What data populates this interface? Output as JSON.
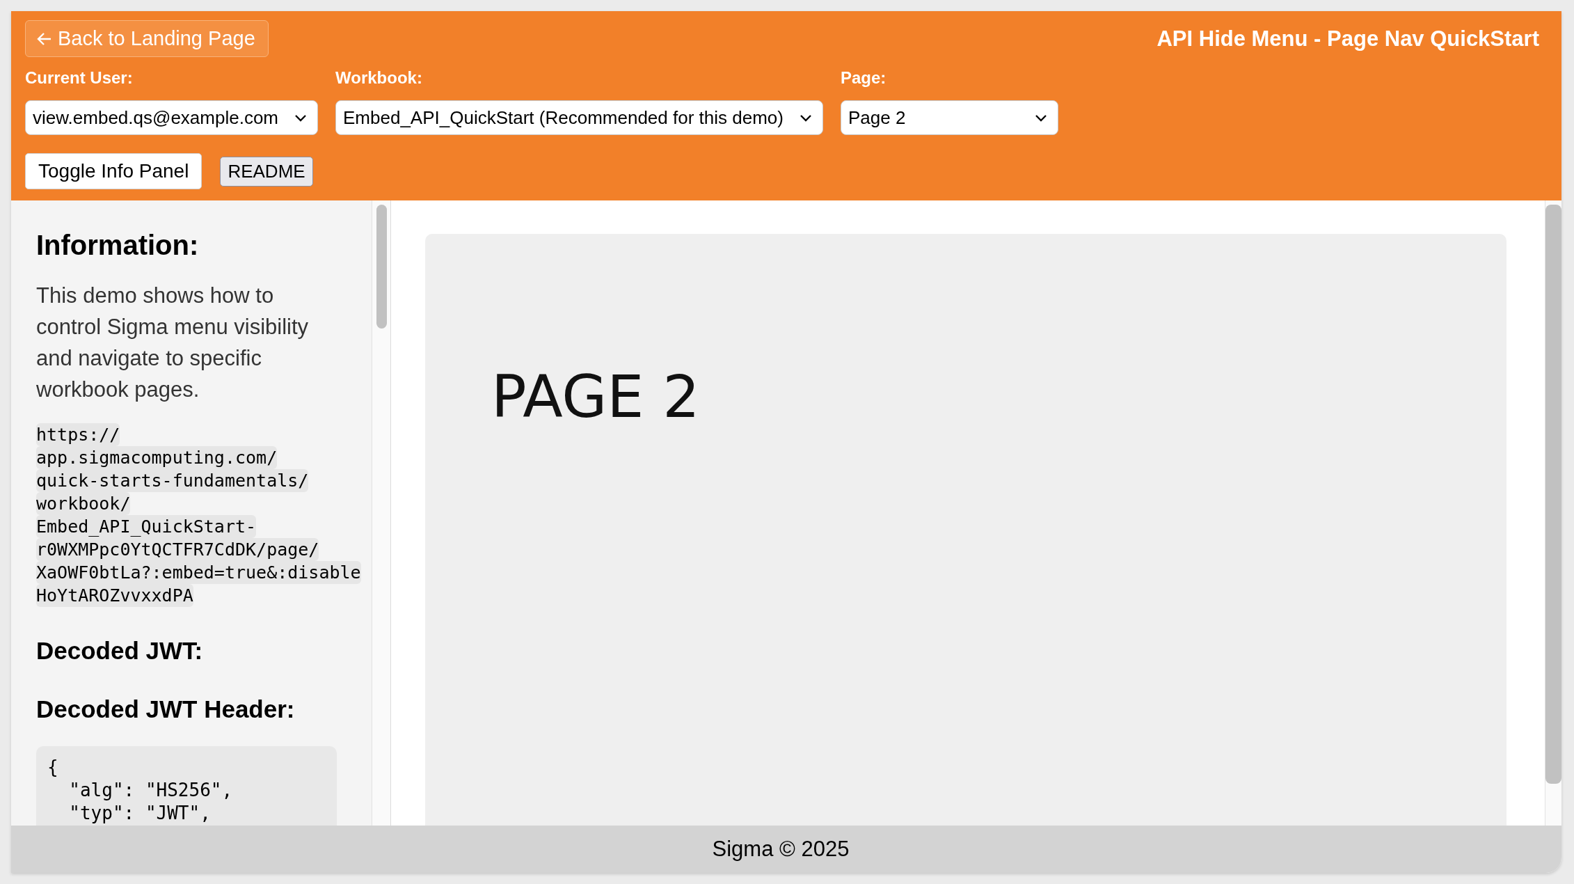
{
  "header": {
    "back_button": "Back to Landing Page",
    "title": "API Hide Menu - Page Nav QuickStart",
    "selectors": [
      {
        "label": "Current User:",
        "value": "view.embed.qs@example.com"
      },
      {
        "label": "Workbook:",
        "value": "Embed_API_QuickStart (Recommended for this demo)"
      },
      {
        "label": "Page:",
        "value": "Page 2"
      }
    ],
    "buttons": [
      {
        "label": "Toggle Info Panel",
        "kind": "primary"
      },
      {
        "label": "README",
        "kind": "plain"
      }
    ]
  },
  "info_panel": {
    "heading": "Information:",
    "description": "This demo shows how to control Sigma menu visibility and navigate to specific workbook pages.",
    "url_lines": [
      "https://",
      "app.sigmacomputing.com/",
      "quick-starts-fundamentals/",
      "workbook/",
      "Embed_API_QuickStart-",
      "r0WXMPpc0YtQCTFR7CdDK/page/",
      "XaOWF0btLa?:embed=true&:disable",
      "HoYtAROZvvxxdPA"
    ],
    "sections": [
      {
        "heading": "Decoded JWT:"
      },
      {
        "heading": "Decoded JWT Header:",
        "code_lines": [
          "{",
          "  \"alg\": \"HS256\",",
          "  \"typ\": \"JWT\","
        ]
      }
    ]
  },
  "content": {
    "page_title": "PAGE 2"
  },
  "footer": "Sigma © 2025"
}
